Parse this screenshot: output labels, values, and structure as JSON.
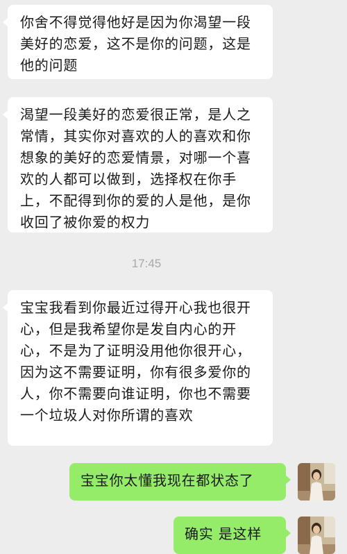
{
  "chat": {
    "messages": [
      {
        "side": "received",
        "text": "你舍不得觉得他好是因为你渴望一段美好的恋爱，这不是你的问题，这是他的问题"
      },
      {
        "side": "received",
        "text": "渴望一段美好的恋爱很正常，是人之常情，其实你对喜欢的人的喜欢和你想象的美好的恋爱情景，对哪一个喜欢的人都可以做到，选择权在你手上，不配得到你的爱的人是他，是你收回了被你爱的权力"
      },
      {
        "side": "received",
        "text": "宝宝我看到你最近过得开心我也很开心，但是我希望你是发自内心的开心，不是为了证明没用他你很开心，因为这不需要证明，你有很多爱你的人，你不需要向谁证明，你也不需要一个垃圾人对你所谓的喜欢"
      },
      {
        "side": "sent",
        "text": "宝宝你太懂我现在都状态了"
      },
      {
        "side": "sent",
        "text": "确实 是这样"
      }
    ],
    "timestamp": "17:45"
  },
  "colors": {
    "background": "#ededed",
    "received_bubble": "#ffffff",
    "sent_bubble": "#95ec69",
    "timestamp_text": "#a8a8a8"
  },
  "icons": {
    "self_avatar": "avatar-photo-icon"
  }
}
